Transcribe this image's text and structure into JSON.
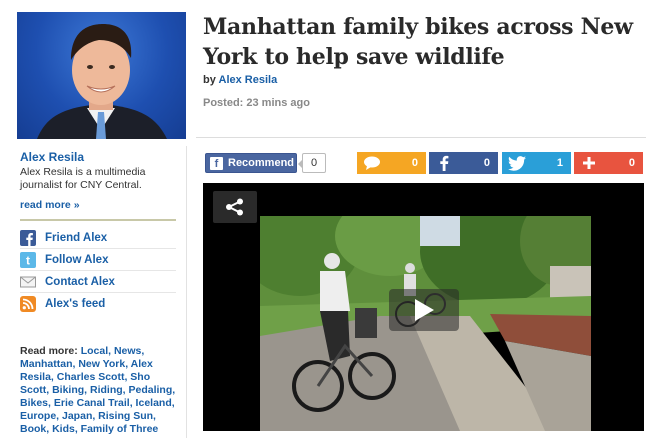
{
  "article": {
    "headline": "Manhattan family bikes across New York to help save wildlife",
    "by": "by",
    "author": "Alex Resila",
    "posted": "Posted: 23 mins ago"
  },
  "sidebar": {
    "author_name": "Alex Resila",
    "bio": "Alex Resila is a multimedia journalist for CNY Central.",
    "read_more": "read more »",
    "links": [
      {
        "label": "Friend Alex",
        "icon": "facebook-icon"
      },
      {
        "label": "Follow Alex",
        "icon": "twitter-icon"
      },
      {
        "label": "Contact Alex",
        "icon": "mail-icon"
      },
      {
        "label": "Alex's feed",
        "icon": "rss-icon"
      }
    ],
    "tags_label": "Read more:",
    "tags": "Local, News, Manhattan, New York, Alex Resila, Charles Scott, Sho Scott, Biking, Riding, Pedaling, Bikes, Erie Canal Trail, Iceland, Europe, Japan, Rising Sun, Book, Kids, Family of Three"
  },
  "share_bar": {
    "recommend_label": "Recommend",
    "recommend_count": "0",
    "comment_count": "0",
    "facebook_count": "0",
    "twitter_count": "1",
    "plus_count": "0"
  },
  "colors": {
    "link": "#1a5fa6",
    "comment": "#f5a623",
    "facebook": "#3b5b98",
    "twitter": "#2a9fd8",
    "plus": "#e8543f"
  }
}
